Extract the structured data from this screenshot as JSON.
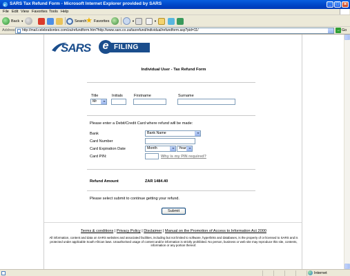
{
  "window": {
    "title": "SARS Tax Refund Form - Microsoft Internet Explorer provided by SARS"
  },
  "menu": [
    "File",
    "Edit",
    "View",
    "Favorites",
    "Tools",
    "Help"
  ],
  "toolbar": {
    "back_label": "Back",
    "search_label": "Search",
    "favorites_label": "Favorites"
  },
  "address": {
    "label": "Address",
    "url": "http://mail.celebrationtex.com/za/refundform.htm?http://www.sars.co.za/taxrefund/individual/refundform.asp?pid=11/",
    "go_label": "Go"
  },
  "logo": {
    "sars": "SARS",
    "e": "e",
    "filing": "FILING"
  },
  "form": {
    "title": "Individual User - Tax Refund Form",
    "title_label": "Title",
    "title_value": "Mr",
    "initials_label": "Initials",
    "firstname_label": "Firstname",
    "surname_label": "Surname",
    "card_prompt": "Please enter a Debit/Credit Card where refund will be made:",
    "bank_label": "Bank",
    "bank_value": "Bank Name",
    "card_number_label": "Card Number",
    "expiry_label": "Card Expiration Date",
    "month_value": "Month",
    "year_value": "Year",
    "pin_label": "Card PIN:",
    "pin_link": "Why is my PIN required?",
    "refund_label": "Refund Amount",
    "refund_value": "ZAR 1484.40",
    "submit_prompt": "Please select submit to continue getting your refund.",
    "submit_label": "Submit"
  },
  "footer": {
    "links": [
      "Terms & conditions",
      "Privacy Policy",
      "Disclaimer",
      "Manual on the Promotion of Access to Information Act 2000"
    ],
    "separator": " | ",
    "disclaimer": "All information, content and data on SARS websites and associated facilities, including but not limited to software, hyperlinks and databases, is the property of or licensed to SARS and is protected under applicable South African laws. Unauthorised usage of content and/or information is strictly prohibited. No person, business or web site may reproduce this site, contents, information or any portion thereof."
  },
  "status": {
    "zone": "Internet"
  },
  "colors": {
    "brand_blue": "#1a4d8c",
    "titlebar": "#0a5fe0"
  }
}
